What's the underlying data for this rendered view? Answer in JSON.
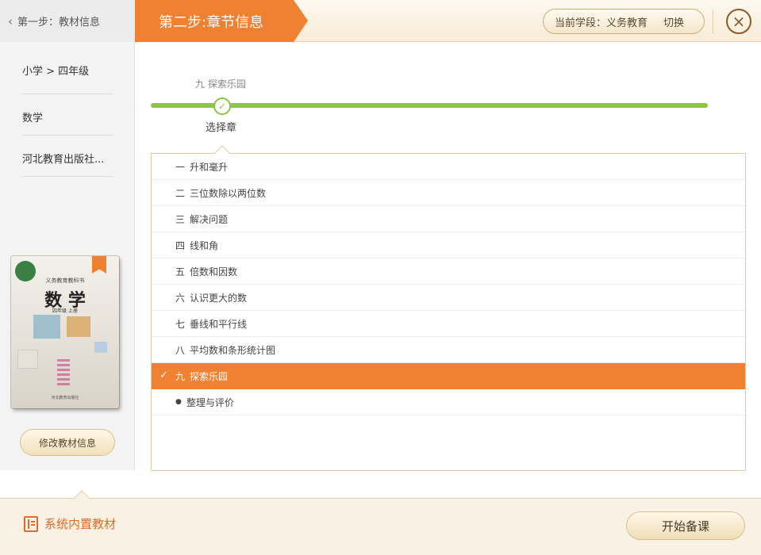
{
  "header": {
    "back_label": "第一步：教材信息",
    "step_title": "第二步:章节信息",
    "stage_label": "当前学段：义务教育",
    "switch_label": "切换",
    "close_symbol": "×",
    "accent_color": "#f08132"
  },
  "sidebar": {
    "level": "小学 > 四年级",
    "subject": "数学",
    "publisher": "河北教育出版社...",
    "book": {
      "series": "义务教育教科书",
      "title": "数 学",
      "grade": "四年级 上册",
      "publisher": "河北教育出版社"
    },
    "edit_button": "修改教材信息"
  },
  "main": {
    "crumb": "九  探索乐园",
    "progress_node_label": "选择章",
    "progress_color": "#8dc63f",
    "chapters": [
      {
        "num": "一",
        "title": "升和毫升",
        "selected": false
      },
      {
        "num": "二",
        "title": "三位数除以两位数",
        "selected": false
      },
      {
        "num": "三",
        "title": "解决问题",
        "selected": false
      },
      {
        "num": "四",
        "title": "线和角",
        "selected": false
      },
      {
        "num": "五",
        "title": "倍数和因数",
        "selected": false
      },
      {
        "num": "六",
        "title": "认识更大的数",
        "selected": false
      },
      {
        "num": "七",
        "title": "垂线和平行线",
        "selected": false
      },
      {
        "num": "八",
        "title": "平均数和条形统计图",
        "selected": false
      },
      {
        "num": "九",
        "title": "探索乐园",
        "selected": true
      },
      {
        "num": "●",
        "title": "整理与评价",
        "selected": false
      }
    ]
  },
  "footer": {
    "builtin_label": "系统内置教材",
    "start_button": "开始备课"
  }
}
